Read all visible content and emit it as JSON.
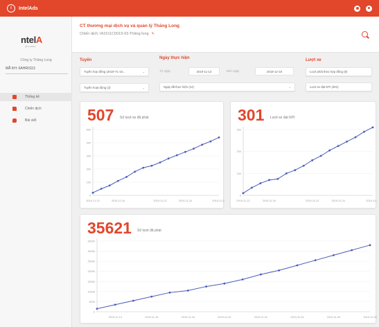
{
  "app": {
    "brand": "IntelAds"
  },
  "sidebar": {
    "logo_main": "ntel",
    "logo_accent": "A",
    "logo_tag": "gôm reklam",
    "company": "Công ty Thăng Long",
    "code": "MÃ KH: 6AHR0113",
    "items": [
      {
        "label": "Thống kê"
      },
      {
        "label": "Chiến dịch"
      },
      {
        "label": "Bài viết"
      }
    ]
  },
  "header": {
    "title": "CT thương mại dịch vụ và quản lý Thăng Long",
    "subtitle": "Chiến dịch: IA1511C0019-03-Thăng long"
  },
  "filters": {
    "tuyen_label": "Tuyến",
    "tuyen_select_1": "Tuyến hợp đồng (2019-TL-10...",
    "tuyen_select_2": "Tuyến hoạt động (3)",
    "date_label": "Ngày thực hiện",
    "from_label": "Từ ngày",
    "from_value": "2019-11-13",
    "to_label": "Đến ngày",
    "to_value": "2019-12-18",
    "date_select": "Ngày đã thực hiện (14)",
    "luot_label": "Lượt xe",
    "luot_1": "Lượt phát theo hợp đồng (8)",
    "luot_2": "Lượt xe đạt KPI (301)"
  },
  "cards": {
    "c1_value": "507",
    "c1_caption": "Số lượt xe đã phát",
    "c2_value": "301",
    "c2_caption": "Lượt xe đạt KPI",
    "c3_value": "35621",
    "c3_caption": "Số lượt đã phát"
  },
  "colors": {
    "accent": "#e2462b",
    "line": "#4a5bb8"
  },
  "chart_data": [
    {
      "type": "line",
      "x": [
        "2019-11-13",
        "2019-11-14",
        "2019-11-15",
        "2019-11-16",
        "2019-11-17",
        "2019-11-18",
        "2019-11-19",
        "2019-11-20",
        "2019-11-21",
        "2019-11-22",
        "2019-11-23",
        "2019-11-24",
        "2019-11-25",
        "2019-11-26",
        "2019-11-27",
        "2019-11-28"
      ],
      "xticks": [
        "2019-11-13",
        "2019-11-16",
        "2019-11-21",
        "2019-11-24",
        "2019-11-28"
      ],
      "values": [
        20,
        50,
        75,
        110,
        140,
        180,
        210,
        225,
        250,
        280,
        305,
        330,
        355,
        385,
        410,
        440
      ],
      "ylim": [
        0,
        500
      ],
      "yticks": [
        0,
        100,
        200,
        300,
        400,
        500
      ]
    },
    {
      "type": "line",
      "x": [
        "2019-11-13",
        "2019-11-14",
        "2019-11-15",
        "2019-11-16",
        "2019-11-17",
        "2019-11-18",
        "2019-11-19",
        "2019-11-20",
        "2019-11-21",
        "2019-11-22",
        "2019-11-23",
        "2019-11-24",
        "2019-11-25",
        "2019-11-26",
        "2019-11-27",
        "2019-11-28"
      ],
      "xticks": [
        "2019-11-13",
        "2019-11-16",
        "2019-11-21",
        "2019-11-24",
        "2019-11-28"
      ],
      "values": [
        10,
        35,
        55,
        70,
        75,
        100,
        115,
        135,
        160,
        180,
        205,
        225,
        245,
        265,
        290,
        310
      ],
      "ylim": [
        0,
        300
      ],
      "yticks": [
        0,
        100,
        200,
        300
      ]
    },
    {
      "type": "line",
      "x": [
        "2019-11-13",
        "2019-11-14",
        "2019-11-15",
        "2019-11-16",
        "2019-11-17",
        "2019-11-18",
        "2019-11-19",
        "2019-11-20",
        "2019-11-21",
        "2019-11-22",
        "2019-11-23",
        "2019-11-24",
        "2019-11-25",
        "2019-11-26",
        "2019-11-27",
        "2019-11-28"
      ],
      "xticks": [
        "2019-11-14",
        "2019-11-16",
        "2019-11-18",
        "2019-11-20",
        "2019-11-22",
        "2019-11-24",
        "2019-11-26",
        "2019-11-28"
      ],
      "values": [
        1500,
        3500,
        5500,
        7500,
        9500,
        10500,
        12500,
        14000,
        16000,
        18500,
        20500,
        23000,
        25500,
        28000,
        30500,
        33000
      ],
      "ylim": [
        0,
        35000
      ],
      "yticks": [
        0,
        5000,
        10000,
        15000,
        20000,
        25000,
        30000,
        35000
      ]
    }
  ]
}
